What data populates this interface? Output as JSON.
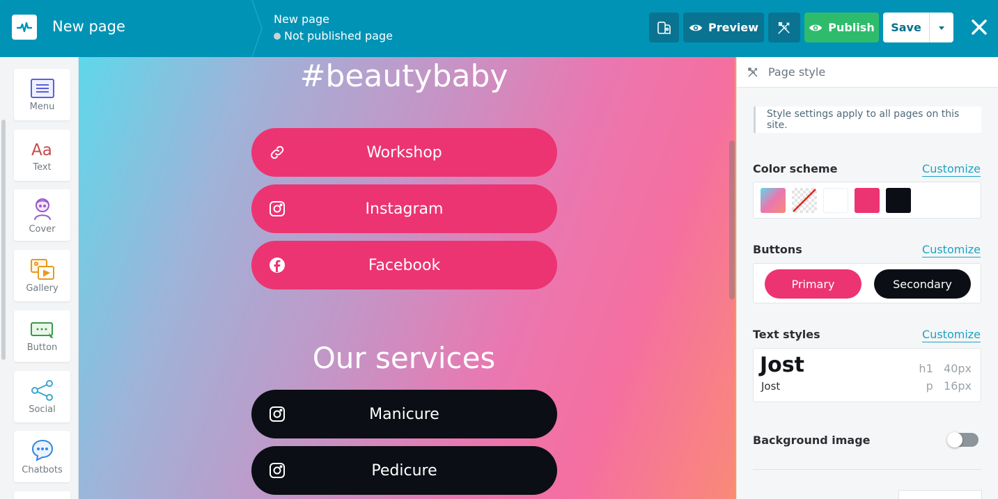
{
  "topbar": {
    "app_title": "New page",
    "page_name": "New page",
    "page_status": "Not published page",
    "preview_label": "Preview",
    "publish_label": "Publish",
    "save_label": "Save",
    "color": "#0093b5"
  },
  "sidebar": {
    "widgets": [
      {
        "label": "Menu",
        "icon": "menu-icon"
      },
      {
        "label": "Text",
        "icon": "text-icon"
      },
      {
        "label": "Cover",
        "icon": "cover-icon"
      },
      {
        "label": "Gallery",
        "icon": "gallery-icon"
      },
      {
        "label": "Button",
        "icon": "button-icon"
      },
      {
        "label": "Social",
        "icon": "social-icon"
      },
      {
        "label": "Chatbots",
        "icon": "chatbots-icon"
      }
    ]
  },
  "canvas": {
    "hashtag": "#beautybaby",
    "links": [
      {
        "label": "Workshop",
        "icon": "link-icon"
      },
      {
        "label": "Instagram",
        "icon": "instagram-icon"
      },
      {
        "label": "Facebook",
        "icon": "facebook-icon"
      }
    ],
    "services_title": "Our services",
    "services": [
      {
        "label": "Manicure",
        "icon": "instagram-icon"
      },
      {
        "label": "Pedicure",
        "icon": "instagram-icon"
      }
    ],
    "primary_color": "#ec3472",
    "secondary_color": "#0b0e14"
  },
  "panel": {
    "title": "Page style",
    "info": "Style settings apply to all pages on this site.",
    "color_scheme": {
      "label": "Color scheme",
      "customize": "Customize",
      "swatches": [
        "gradient",
        "transparent",
        "#ffffff",
        "#ec3472",
        "#0b0e14"
      ]
    },
    "buttons": {
      "label": "Buttons",
      "customize": "Customize",
      "primary": "Primary",
      "secondary": "Secondary"
    },
    "text_styles": {
      "label": "Text styles",
      "customize": "Customize",
      "heading_font": "Jost",
      "body_font": "Jost",
      "h1_tag": "h1",
      "h1_size": "40px",
      "p_tag": "p",
      "p_size": "16px"
    },
    "background_image": {
      "label": "Background image",
      "enabled": false
    }
  }
}
